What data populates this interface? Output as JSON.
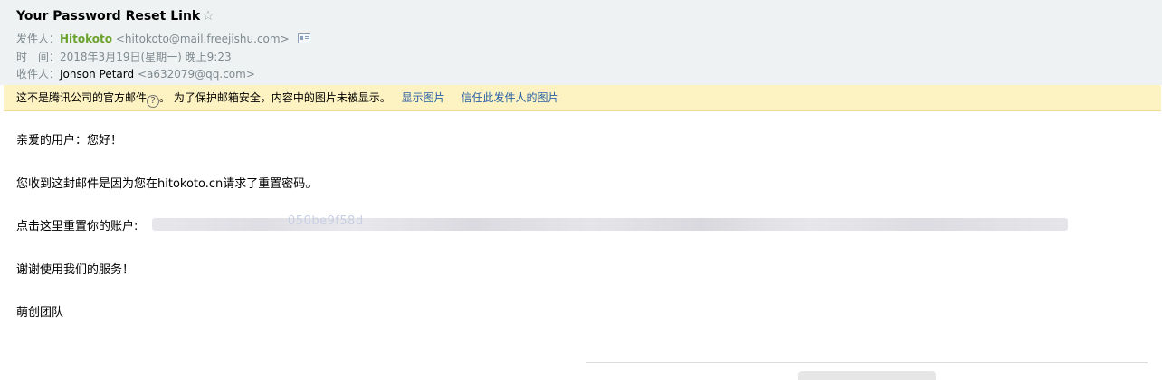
{
  "mail": {
    "subject": "Your Password Reset Link",
    "star_glyph": "☆",
    "from_label": "发件人：",
    "from_name": "Hitokoto",
    "from_address": "<hitokoto@mail.freejishu.com>",
    "time_label": "时　间：",
    "time_value": "2018年3月19日(星期一) 晚上9:23",
    "to_label": "收件人：",
    "to_name": "Jonson Petard",
    "to_address": "<a632079@qq.com>"
  },
  "warning": {
    "text": "这不是腾讯公司的官方邮件",
    "help_glyph": "?",
    "text2": "。 为了保护邮箱安全，内容中的图片未被显示。",
    "show_images": "显示图片",
    "trust_sender": "信任此发件人的图片"
  },
  "body": {
    "greeting": "亲爱的用户：您好！",
    "reason": "您收到这封邮件是因为您在hitokoto.cn请求了重置密码。",
    "link_prefix": "点击这里重置你的账户:",
    "link_visible_fragment": "050be9f58d",
    "thanks": "谢谢使用我们的服务！",
    "signature": "萌创团队"
  },
  "icons": {
    "star": "star-icon",
    "contact_card": "contact-card-icon",
    "help": "help-icon"
  },
  "colors": {
    "header_bg": "#eff2f2",
    "warning_bg": "#fdf2c2",
    "sender_name": "#6aa22d",
    "link": "#2a62a8"
  }
}
